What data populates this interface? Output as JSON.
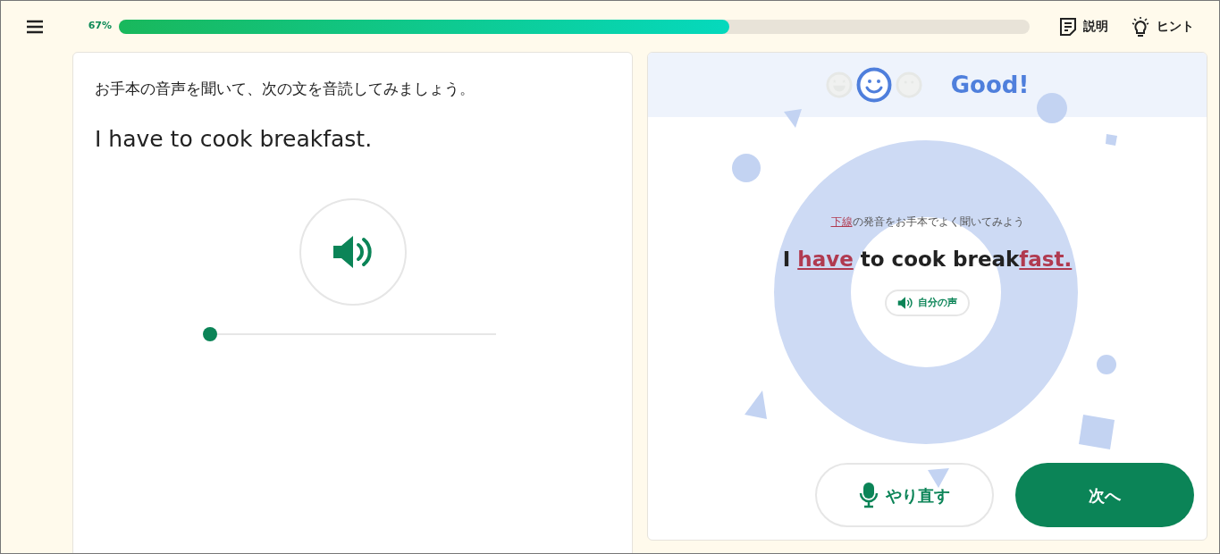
{
  "progress": {
    "label": "67%",
    "level": 0.67
  },
  "header_buttons": [
    {
      "kind": "manual",
      "label": "説明"
    },
    {
      "kind": "hint",
      "label": "ヒント"
    }
  ],
  "prompt": {
    "instruction": "お手本の音声を聞いて、次の文を音読してみましょう。",
    "sentence": "I have to cook breakfast.",
    "audio": {
      "level": 0
    }
  },
  "result": {
    "faces": [
      {
        "kind": "great",
        "selected": false
      },
      {
        "kind": "good",
        "selected": true
      },
      {
        "kind": "plain",
        "selected": false
      }
    ],
    "rating": "Good!",
    "note": [
      {
        "text": "下線",
        "underlined": true
      },
      {
        "text": "の発音をお手本でよく聞いてみよう",
        "underlined": false
      }
    ],
    "sentence": [
      {
        "text": "I ",
        "underlined": false
      },
      {
        "text": "have",
        "underlined": true
      },
      {
        "text": " to cook break",
        "underlined": false
      },
      {
        "text": "fast.",
        "underlined": true
      }
    ],
    "own_voice": "自分の声"
  },
  "actions": [
    {
      "kind": "retry",
      "label": "やり直す"
    },
    {
      "kind": "next",
      "label": "次へ"
    }
  ]
}
